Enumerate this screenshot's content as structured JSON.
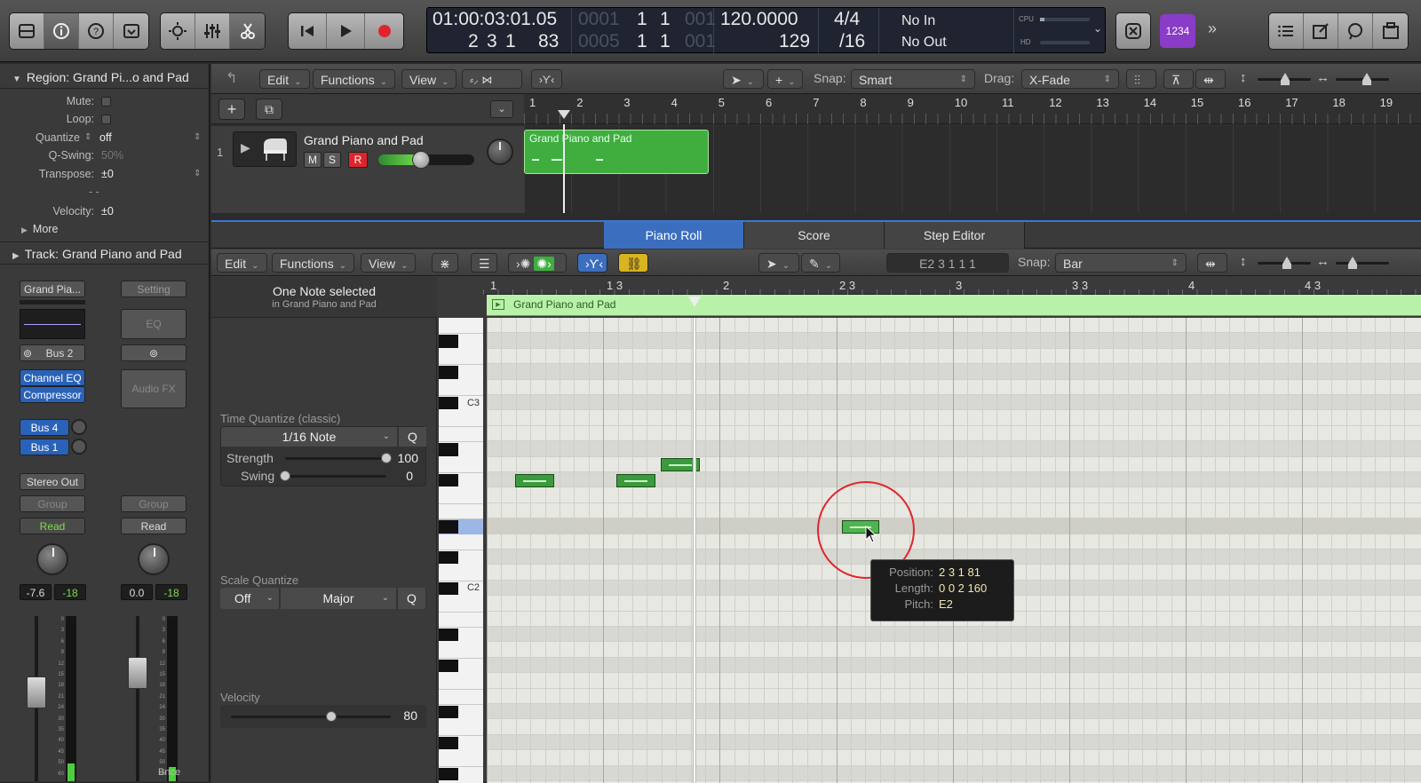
{
  "colors": {
    "accent_blue": "#3c6ebf",
    "record_red": "#e0242c",
    "region_green": "#3fae3f",
    "note_green": "#3b9a3b",
    "highlight_red": "#e0242c",
    "lcd_bg": "#1f2430"
  },
  "transport": {
    "smpte_time": "01:00:03:01.05",
    "bars_beats": [
      "2",
      "3",
      "1",
      "83"
    ],
    "ghost_top": [
      "0001",
      "1",
      "1",
      "001"
    ],
    "ghost_bottom": [
      "0005",
      "1",
      "1",
      "001"
    ],
    "tempo": "120.0000",
    "tempo_sub": "129",
    "time_sig": "4/4",
    "division": "/16",
    "midi_in": "No In",
    "midi_out": "No Out",
    "cpu_label": "CPU",
    "hd_label": "HD",
    "counter_badge": "1234"
  },
  "region_inspector": {
    "header": "Region: Grand Pi...o and Pad",
    "mute_label": "Mute:",
    "loop_label": "Loop:",
    "quantize_label": "Quantize",
    "quantize_value": "off",
    "qswing_label": "Q-Swing:",
    "qswing_value": "50%",
    "transpose_label": "Transpose:",
    "transpose_value": "±0",
    "dash_value": "- -",
    "velocity_label": "Velocity:",
    "velocity_value": "±0",
    "more_label": "More"
  },
  "track_inspector": {
    "header": "Track: Grand Piano and Pad",
    "strip1": {
      "name": "Grand Pia...",
      "bus": "Bus 2",
      "plugin1": "Channel EQ",
      "plugin2": "Compressor",
      "send1": "Bus 4",
      "send2": "Bus 1",
      "output": "Stereo Out",
      "group": "Group",
      "automation": "Read",
      "pan_value": "-7.6",
      "level_value": "-18"
    },
    "strip2": {
      "name": "Setting",
      "eq": "EQ",
      "audio_fx": "Audio FX",
      "group": "Group",
      "automation": "Read",
      "pan_value": "0.0",
      "level_value": "-18",
      "footer": "Bnce"
    },
    "meter_scale": [
      "0",
      "3",
      "6",
      "9",
      "12",
      "15",
      "18",
      "21",
      "24",
      "30",
      "35",
      "40",
      "45",
      "50",
      "60"
    ]
  },
  "tracks_toolbar": {
    "edit": "Edit",
    "functions": "Functions",
    "view": "View",
    "snap_label": "Snap:",
    "snap_value": "Smart",
    "drag_label": "Drag:",
    "drag_value": "X-Fade"
  },
  "tracks_ruler": [
    "1",
    "2",
    "3",
    "4",
    "5",
    "6",
    "7",
    "8",
    "9",
    "10",
    "11",
    "12",
    "13",
    "14",
    "15",
    "16",
    "17",
    "18",
    "19"
  ],
  "track": {
    "number": "1",
    "name": "Grand Piano and Pad",
    "mute": "M",
    "solo": "S",
    "record": "R",
    "region_name": "Grand Piano and Pad"
  },
  "editor_tabs": [
    {
      "label": "Piano Roll",
      "active": true
    },
    {
      "label": "Score",
      "active": false
    },
    {
      "label": "Step Editor",
      "active": false
    }
  ],
  "piano_toolbar": {
    "edit": "Edit",
    "functions": "Functions",
    "view": "View",
    "position_readout": "E2   3 1 1 1",
    "snap_label": "Snap:",
    "snap_value": "Bar"
  },
  "piano_panel": {
    "selection_title": "One Note selected",
    "selection_sub": "in Grand Piano and Pad",
    "time_quantize_label": "Time Quantize (classic)",
    "quantize_value": "1/16 Note",
    "q_button": "Q",
    "strength_label": "Strength",
    "strength_value": "100",
    "strength_fraction": 1.0,
    "swing_label": "Swing",
    "swing_value": "0",
    "swing_fraction": 0.0,
    "scale_quantize_label": "Scale Quantize",
    "scale_off": "Off",
    "scale_mode": "Major",
    "velocity_label": "Velocity",
    "velocity_value": "80",
    "velocity_fraction": 0.63
  },
  "piano_ruler": [
    "1",
    "1 3",
    "2",
    "2 3",
    "3",
    "3 3",
    "4",
    "4 3"
  ],
  "piano_keys": {
    "c3": "C3",
    "c2": "C2"
  },
  "piano_region_name": "Grand Piano and Pad",
  "tooltip": {
    "position_label": "Position:",
    "position_value": "2 3 1 81",
    "length_label": "Length:",
    "length_value": "0 0 2 160",
    "pitch_label": "Pitch:",
    "pitch_value": "E2"
  }
}
